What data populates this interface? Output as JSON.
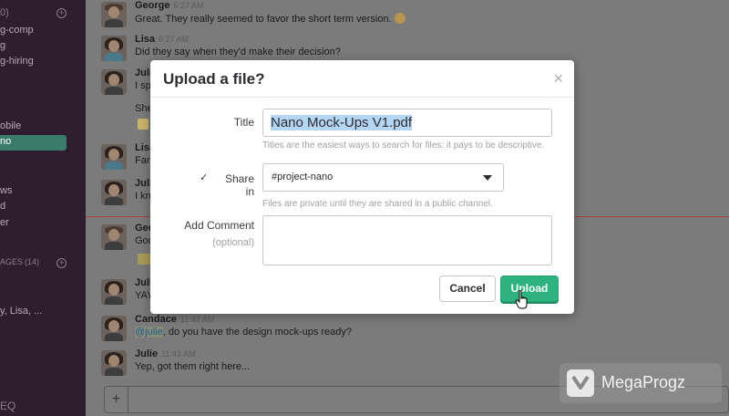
{
  "sidebar": {
    "lines": [
      {
        "text": "0)"
      },
      {
        "text": "g-comp"
      },
      {
        "text": "g"
      },
      {
        "text": "g-hiring"
      },
      {
        "text": "obile"
      },
      {
        "text": "ws"
      },
      {
        "text": "d"
      },
      {
        "text": "er"
      },
      {
        "text": "AGES"
      },
      {
        "text": "(14)"
      },
      {
        "text": "y, Lisa, ..."
      }
    ],
    "active_item": "no",
    "search_icon": "EQ"
  },
  "messages": [
    {
      "author": "George",
      "time": "6:27 AM",
      "text": "Great. They really seemed to favor the short term version."
    },
    {
      "author": "Lisa",
      "time": "6:27 AM",
      "text": "Did they say when they'd make their decision?"
    },
    {
      "author": "Juli",
      "time": "",
      "text": "I sp"
    },
    {
      "author": "",
      "time": "",
      "text": "She"
    },
    {
      "author": "Lisa",
      "time": "",
      "text": "Fan"
    },
    {
      "author": "Julie",
      "time": "",
      "text": "I kn"
    },
    {
      "author": "Geo",
      "time": "",
      "text": "Goo"
    },
    {
      "author": "Juli",
      "time": "",
      "text": "YAY"
    },
    {
      "author": "Candace",
      "time": "11:43 AM",
      "mention": "@julie",
      "text": ", do you have the design mock-ups ready?"
    },
    {
      "author": "Julie",
      "time": "11:43 AM",
      "text": "Yep, got them right here..."
    }
  ],
  "input": {
    "plus_label": "+"
  },
  "watermark": {
    "text": "MegaProgz"
  },
  "modal": {
    "title": "Upload a file?",
    "close_label": "×",
    "title_label": "Title",
    "title_value": "Nano Mock-Ups V1.pdf",
    "title_hint": "Titles are the easiest ways to search for files: it pays to be descriptive.",
    "share_checkbox": "✓",
    "share_label": "Share in",
    "share_value": "#project-nano",
    "share_hint": "Files are private until they are shared in a public channel.",
    "comment_label": "Add Comment",
    "comment_sublabel": "(optional)",
    "cancel_label": "Cancel",
    "upload_label": "Upload"
  },
  "colors": {
    "upload_button": "#2fb37e",
    "sidebar_bg": "#2f1f2e",
    "active_channel": "#3a7b6a"
  }
}
